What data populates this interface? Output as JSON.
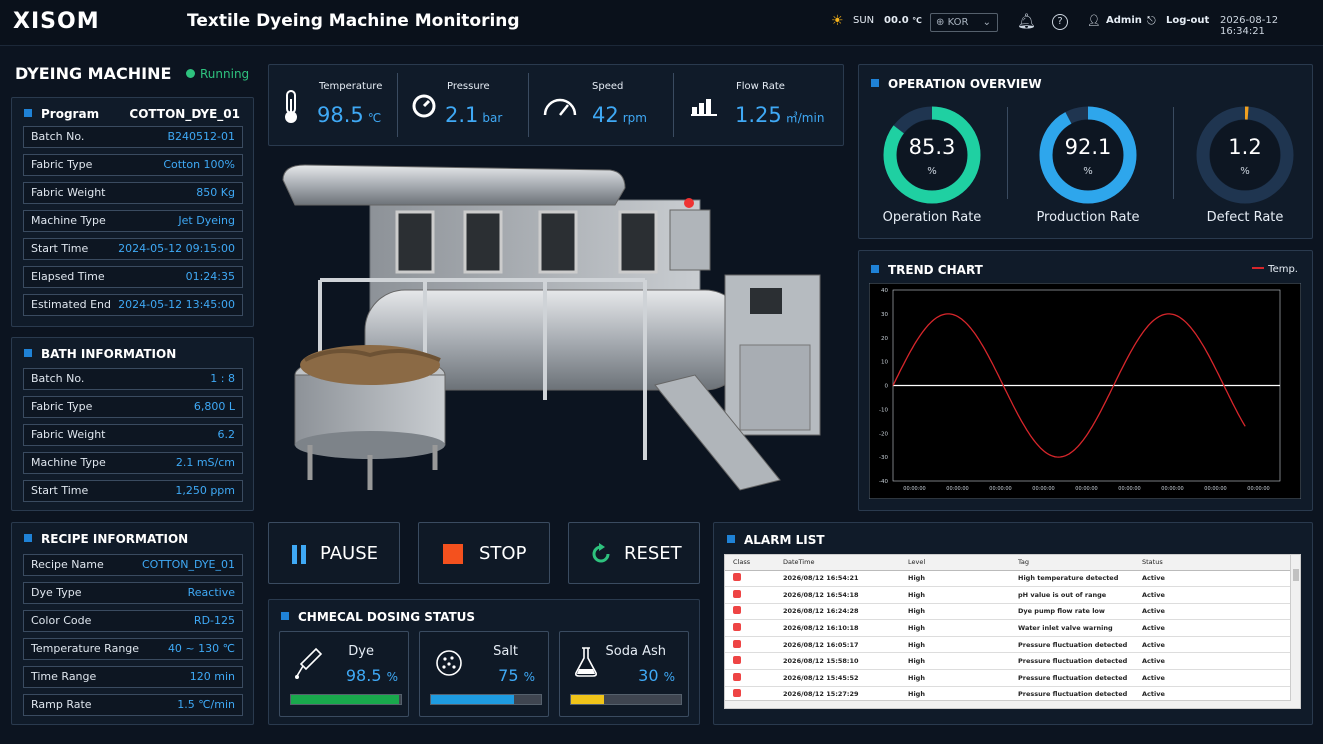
{
  "header": {
    "logo": "XISOM",
    "title": "Textile Dyeing Machine Monitoring",
    "weather": "SUN",
    "temp": "00.0",
    "temp_unit": "℃",
    "lang": "KOR",
    "user": "Admin",
    "logout": "Log-out",
    "datetime": "2026-08-12  16:34:21"
  },
  "machine": {
    "title": "DYEING MACHINE",
    "status": "Running"
  },
  "program": {
    "label": "Program",
    "name": "COTTON_DYE_01",
    "rows": [
      {
        "k": "Batch No.",
        "v": "B240512-01"
      },
      {
        "k": "Fabric Type",
        "v": "Cotton 100%"
      },
      {
        "k": "Fabric Weight",
        "v": "850 Kg"
      },
      {
        "k": "Machine Type",
        "v": "Jet Dyeing"
      },
      {
        "k": "Start Time",
        "v": "2024-05-12 09:15:00"
      },
      {
        "k": "Elapsed Time",
        "v": "01:24:35"
      },
      {
        "k": "Estimated End",
        "v": "2024-05-12 13:45:00"
      }
    ]
  },
  "bath": {
    "title": "BATH INFORMATION",
    "rows": [
      {
        "k": "Batch No.",
        "v": "1 : 8"
      },
      {
        "k": "Fabric Type",
        "v": "6,800 L"
      },
      {
        "k": "Fabric Weight",
        "v": "6.2"
      },
      {
        "k": "Machine Type",
        "v": "2.1 mS/cm"
      },
      {
        "k": "Start Time",
        "v": "1,250 ppm"
      }
    ]
  },
  "recipe": {
    "title": "RECIPE INFORMATION",
    "rows": [
      {
        "k": "Recipe Name",
        "v": "COTTON_DYE_01"
      },
      {
        "k": "Dye Type",
        "v": "Reactive"
      },
      {
        "k": "Color Code",
        "v": "RD-125"
      },
      {
        "k": "Temperature Range",
        "v": "40 ~ 130 ℃"
      },
      {
        "k": "Time Range",
        "v": "120 min"
      },
      {
        "k": "Ramp Rate",
        "v": "1.5 ℃/min"
      }
    ]
  },
  "stats": [
    {
      "label": "Temperature",
      "value": "98.5",
      "unit": "℃"
    },
    {
      "label": "Pressure",
      "value": "2.1",
      "unit": "bar"
    },
    {
      "label": "Speed",
      "value": "42",
      "unit": "rpm"
    },
    {
      "label": "Flow Rate",
      "value": "1.25",
      "unit": "㎥/min"
    }
  ],
  "overview": {
    "title": "OPERATION OVERVIEW",
    "gauges": [
      {
        "value": "85.3",
        "unit": "%",
        "label": "Operation Rate",
        "pct": 85.3,
        "color": "#1fd0a2"
      },
      {
        "value": "92.1",
        "unit": "%",
        "label": "Production Rate",
        "pct": 92.1,
        "color": "#2ea6ec"
      },
      {
        "value": "1.2",
        "unit": "%",
        "label": "Defect Rate",
        "pct": 1.2,
        "color": "#f0a020"
      }
    ]
  },
  "trend": {
    "title": "TREND CHART",
    "legend": "Temp."
  },
  "chart_data": {
    "type": "line",
    "title": "TREND CHART",
    "series": [
      {
        "name": "Temp.",
        "color": "#d7262b",
        "amplitude": 30,
        "period_fraction": 0.57
      }
    ],
    "ylim": [
      -40,
      40
    ],
    "yticks": [
      40,
      30,
      20,
      10,
      0,
      -10,
      -20,
      -30,
      -40
    ],
    "xticks": [
      "00:00:00",
      "00:00:00",
      "00:00:00",
      "00:00:00",
      "00:00:00",
      "00:00:00",
      "00:00:00",
      "00:00:00",
      "00:00:00"
    ],
    "grid": false
  },
  "controls": {
    "pause": "PAUSE",
    "stop": "STOP",
    "reset": "RESET"
  },
  "dosing": {
    "title": "CHMECAL DOSING STATUS",
    "items": [
      {
        "name": "Dye",
        "value": "98.5",
        "unit": "%",
        "fill": 98.5,
        "color": "#19a84c"
      },
      {
        "name": "Salt",
        "value": "75",
        "unit": "%",
        "fill": 75,
        "color": "#1e9be0"
      },
      {
        "name": "Soda Ash",
        "value": "30",
        "unit": "%",
        "fill": 30,
        "color": "#f0c419"
      }
    ]
  },
  "alarms": {
    "title": "ALARM LIST",
    "columns": [
      "Class",
      "DateTime",
      "Level",
      "Tag",
      "Status"
    ],
    "rows": [
      [
        "2026/08/12 16:54:21",
        "High",
        "High temperature detected",
        "Active"
      ],
      [
        "2026/08/12 16:54:18",
        "High",
        "pH value is out of range",
        "Active"
      ],
      [
        "2026/08/12 16:24:28",
        "High",
        "Dye pump flow rate low",
        "Active"
      ],
      [
        "2026/08/12 16:10:18",
        "High",
        "Water inlet valve warning",
        "Active"
      ],
      [
        "2026/08/12 16:05:17",
        "High",
        "Pressure fluctuation detected",
        "Active"
      ],
      [
        "2026/08/12 15:58:10",
        "High",
        "Pressure fluctuation detected",
        "Active"
      ],
      [
        "2026/08/12 15:45:52",
        "High",
        "Pressure fluctuation detected",
        "Active"
      ],
      [
        "2026/08/12 15:27:29",
        "High",
        "Pressure fluctuation detected",
        "Active"
      ]
    ]
  }
}
